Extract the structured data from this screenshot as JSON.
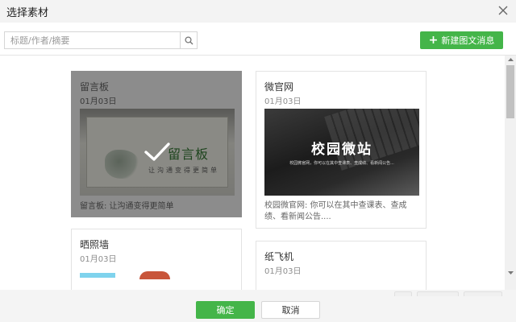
{
  "dialog": {
    "title": "选择素材"
  },
  "search": {
    "placeholder": "标题/作者/摘要"
  },
  "toolbar": {
    "new_label": "新建图文消息"
  },
  "cards": [
    {
      "title": "留言板",
      "date": "01月03日",
      "thumb_title": "留言板",
      "thumb_sub": "让沟通变得更简单",
      "desc": "留言板: 让沟通变得更简单",
      "selected": true
    },
    {
      "title": "微官网",
      "date": "01月03日",
      "thumb_title": "校园微站",
      "thumb_sub": "校园微官网，你可以在其中查课表、查成绩、看新闻公告...",
      "desc": "校园微官网: 你可以在其中查课表、查成绩、看新闻公告...."
    },
    {
      "title": "晒照墙",
      "date": "01月03日"
    },
    {
      "title": "纸飞机",
      "date": "01月03日"
    }
  ],
  "footer": {
    "ok_label": "确定",
    "cancel_label": "取消"
  },
  "colors": {
    "primary": "#44b549",
    "selected_overlay": "#8c8c8c"
  }
}
